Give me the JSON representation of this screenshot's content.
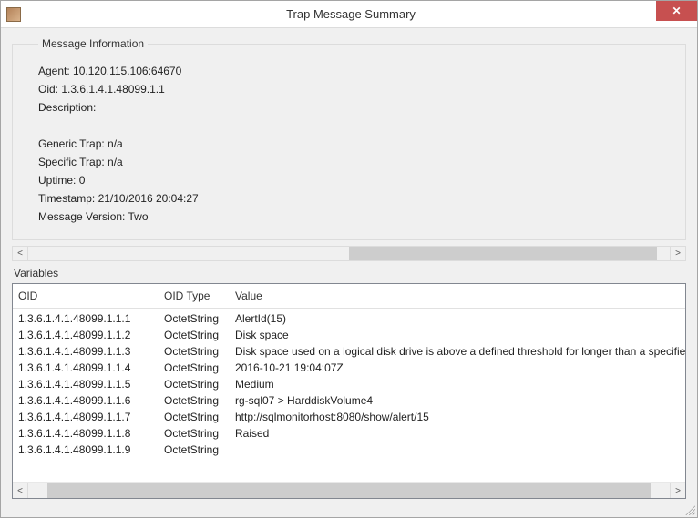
{
  "window": {
    "title": "Trap Message Summary"
  },
  "messageInfo": {
    "legend": "Message Information",
    "agent_label": "Agent:",
    "agent_value": "10.120.115.106:64670",
    "oid_label": "Oid:",
    "oid_value": "1.3.6.1.4.1.48099.1.1",
    "description_label": "Description:",
    "description_value": "",
    "generic_trap_label": "Generic Trap:",
    "generic_trap_value": "n/a",
    "specific_trap_label": "Specific Trap:",
    "specific_trap_value": "n/a",
    "uptime_label": "Uptime:",
    "uptime_value": "0",
    "timestamp_label": "Timestamp:",
    "timestamp_value": "21/10/2016 20:04:27",
    "version_label": "Message Version:",
    "version_value": "Two"
  },
  "variables": {
    "section_label": "Variables",
    "columns": {
      "oid": "OID",
      "type": "OID Type",
      "value": "Value"
    },
    "rows": [
      {
        "oid": "1.3.6.1.4.1.48099.1.1.1",
        "type": "OctetString",
        "value": "AlertId(15)"
      },
      {
        "oid": "1.3.6.1.4.1.48099.1.1.2",
        "type": "OctetString",
        "value": "Disk space"
      },
      {
        "oid": "1.3.6.1.4.1.48099.1.1.3",
        "type": "OctetString",
        "value": "Disk space used on a logical disk drive is above a defined threshold for longer than a specified duration."
      },
      {
        "oid": "1.3.6.1.4.1.48099.1.1.4",
        "type": "OctetString",
        "value": "2016-10-21 19:04:07Z"
      },
      {
        "oid": "1.3.6.1.4.1.48099.1.1.5",
        "type": "OctetString",
        "value": "Medium"
      },
      {
        "oid": "1.3.6.1.4.1.48099.1.1.6",
        "type": "OctetString",
        "value": "rg-sql07 > HarddiskVolume4"
      },
      {
        "oid": "1.3.6.1.4.1.48099.1.1.7",
        "type": "OctetString",
        "value": "http://sqlmonitorhost:8080/show/alert/15"
      },
      {
        "oid": "1.3.6.1.4.1.48099.1.1.8",
        "type": "OctetString",
        "value": "Raised"
      },
      {
        "oid": "1.3.6.1.4.1.48099.1.1.9",
        "type": "OctetString",
        "value": ""
      }
    ]
  }
}
